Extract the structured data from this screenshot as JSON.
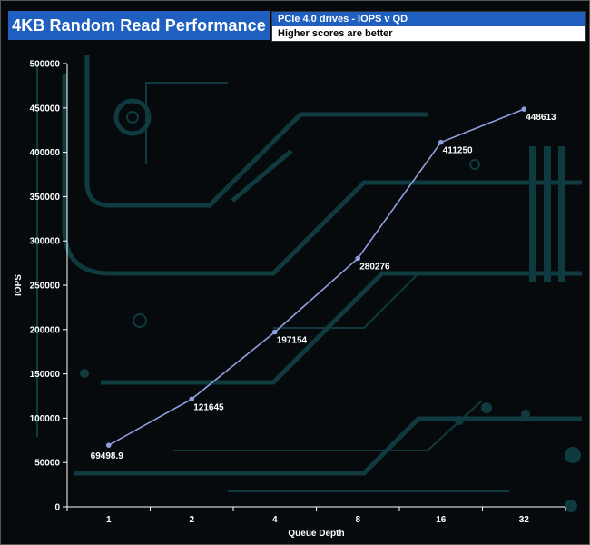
{
  "header": {
    "title": "4KB Random Read Performance",
    "subtitle": "PCIe 4.0 drives - IOPS v QD",
    "note": "Higher scores are better"
  },
  "chart_data": {
    "type": "line",
    "categories": [
      "1",
      "2",
      "4",
      "8",
      "16",
      "32"
    ],
    "series": [
      {
        "values": [
          69498.9,
          121645,
          197154,
          280276,
          411250,
          448613
        ]
      }
    ],
    "data_labels": [
      "69498.9",
      "121645",
      "197154",
      "280276",
      "411250",
      "448613"
    ],
    "xlabel": "Queue Depth",
    "ylabel": "IOPS",
    "ylim": [
      0,
      500000
    ],
    "yticks": [
      0,
      50000,
      100000,
      150000,
      200000,
      250000,
      300000,
      350000,
      400000,
      450000,
      500000
    ],
    "ytick_labels": [
      "0",
      "50000",
      "100000",
      "150000",
      "200000",
      "250000",
      "300000",
      "350000",
      "400000",
      "450000",
      "500000"
    ],
    "grid": false,
    "legend": "none",
    "colors": {
      "line": "#8f9fe0",
      "marker": "#8f9fe0",
      "header_bg": "#1f5fbf",
      "background": "#070a0c",
      "circuit": "#0f3a3f"
    }
  }
}
